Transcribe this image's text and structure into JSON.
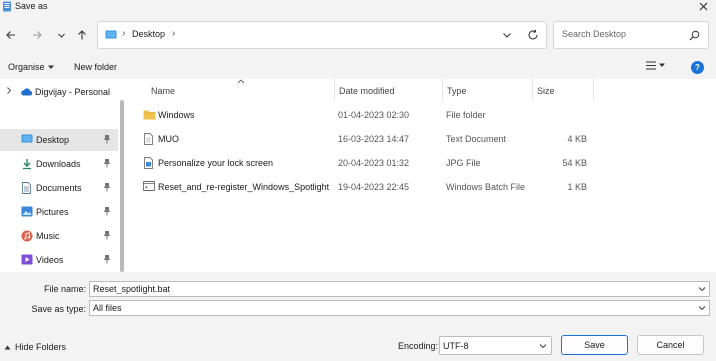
{
  "window": {
    "title": "Save as",
    "close_icon": "close-icon"
  },
  "nav": {
    "breadcrumb": "Desktop",
    "separator": "›",
    "search_placeholder": "Search Desktop"
  },
  "toolbar": {
    "organise_label": "Organise",
    "new_folder_label": "New folder"
  },
  "sidebar": {
    "onedrive_label": "Digvijay - Personal",
    "items": [
      {
        "label": "Desktop",
        "icon": "desktop-icon",
        "selected": true
      },
      {
        "label": "Downloads",
        "icon": "download-icon",
        "selected": false
      },
      {
        "label": "Documents",
        "icon": "document-icon",
        "selected": false
      },
      {
        "label": "Pictures",
        "icon": "pictures-icon",
        "selected": false
      },
      {
        "label": "Music",
        "icon": "music-icon",
        "selected": false
      },
      {
        "label": "Videos",
        "icon": "videos-icon",
        "selected": false
      }
    ]
  },
  "columns": {
    "name": "Name",
    "date": "Date modified",
    "type": "Type",
    "size": "Size"
  },
  "files": [
    {
      "name": "Windows",
      "date": "01-04-2023 02:30",
      "type": "File folder",
      "size": "",
      "icon": "folder-icon"
    },
    {
      "name": "MUO",
      "date": "16-03-2023 14:47",
      "type": "Text Document",
      "size": "4 KB",
      "icon": "text-file-icon"
    },
    {
      "name": "Personalize your lock screen",
      "date": "20-04-2023 01:32",
      "type": "JPG File",
      "size": "54 KB",
      "icon": "image-file-icon"
    },
    {
      "name": "Reset_and_re-register_Windows_Spotlight",
      "date": "19-04-2023 22:45",
      "type": "Windows Batch File",
      "size": "1 KB",
      "icon": "batch-file-icon"
    }
  ],
  "form": {
    "file_name_label": "File name:",
    "file_name_value": "Reset_spotlight.bat",
    "save_as_type_label": "Save as type:",
    "save_as_type_value": "All files"
  },
  "footer": {
    "hide_folders_label": "Hide Folders",
    "encoding_label": "Encoding:",
    "encoding_value": "UTF-8",
    "save_label": "Save",
    "cancel_label": "Cancel"
  },
  "colors": {
    "accent": "#1a73d9",
    "folder": "#f2c14e",
    "selected_bg": "#e5e5e5"
  }
}
